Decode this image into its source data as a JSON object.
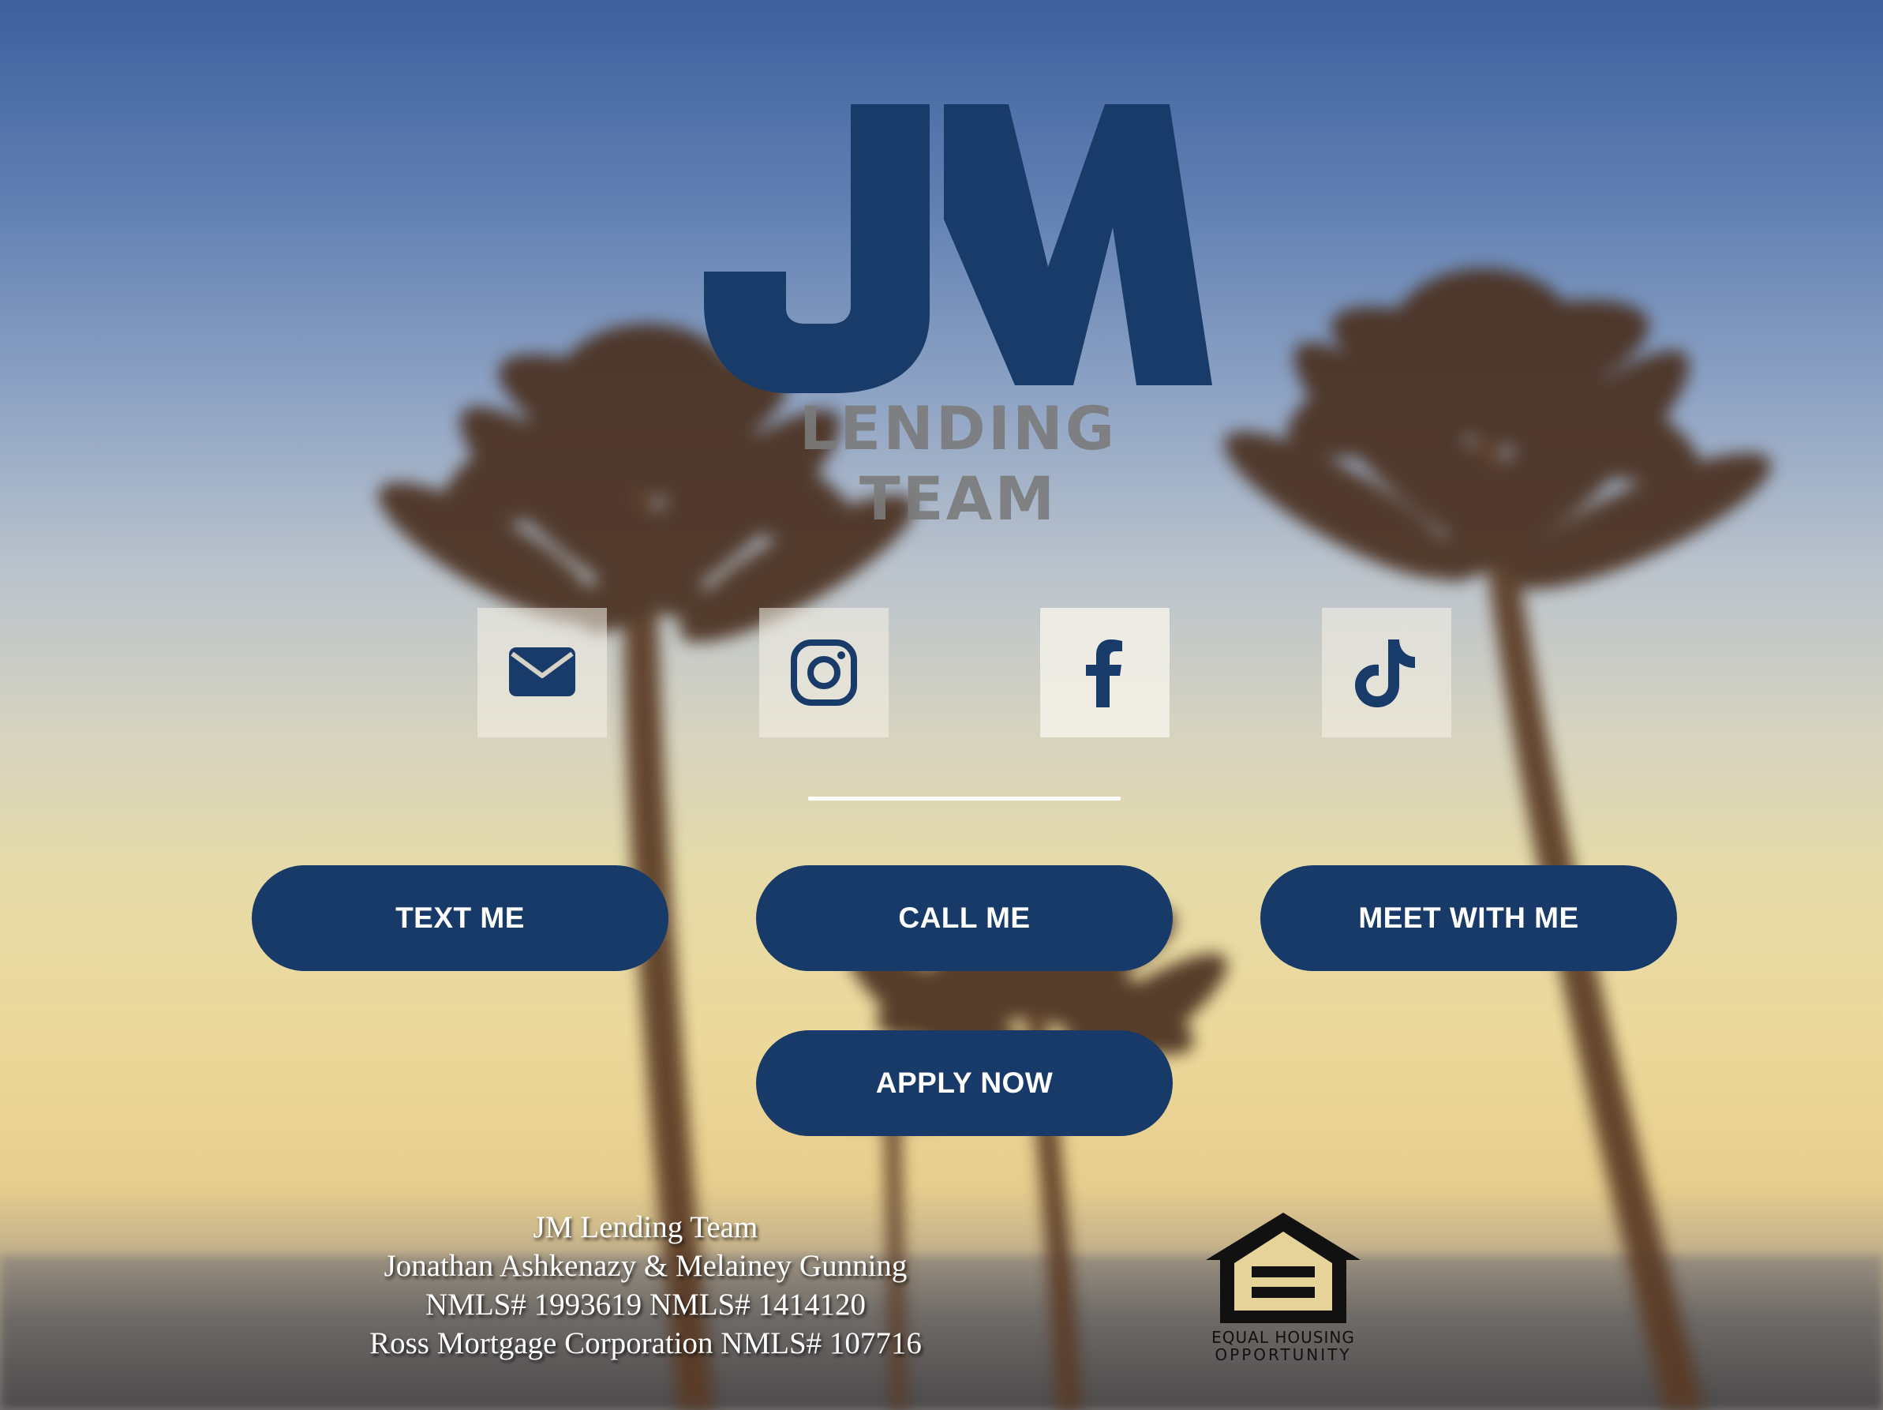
{
  "logo": {
    "title": "JM",
    "subtitle": "LENDING TEAM"
  },
  "social": [
    {
      "name": "email",
      "icon": "mail-icon"
    },
    {
      "name": "instagram",
      "icon": "instagram-icon"
    },
    {
      "name": "facebook",
      "icon": "facebook-icon"
    },
    {
      "name": "tiktok",
      "icon": "tiktok-icon"
    }
  ],
  "buttons": {
    "text_me": "TEXT ME",
    "call_me": "CALL ME",
    "meet_with_me": "MEET WITH ME",
    "apply_now": "APPLY NOW"
  },
  "footer": {
    "line1": "JM Lending Team",
    "line2": "Jonathan Ashkenazy & Melainey Gunning",
    "line3": "NMLS# 1993619 NMLS# 1414120",
    "line4": "Ross Mortgage Corporation NMLS# 107716"
  },
  "equal_housing": {
    "line1": "EQUAL HOUSING",
    "line2": "OPPORTUNITY"
  },
  "colors": {
    "brand_navy": "#173a68",
    "logo_gray": "#7b7b7b"
  }
}
